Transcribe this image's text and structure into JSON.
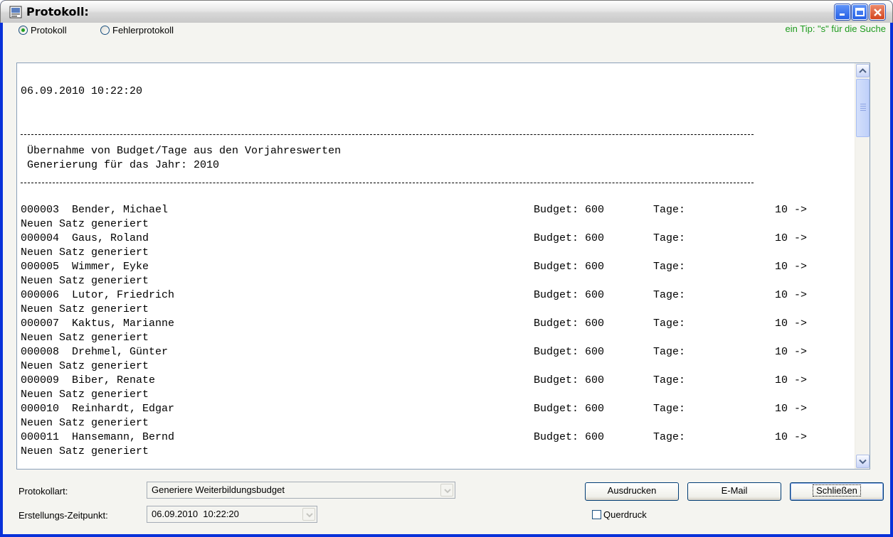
{
  "window": {
    "title": "Protokoll:"
  },
  "mode": {
    "protokoll_label": "Protokoll",
    "fehlerprotokoll_label": "Fehlerprotokoll",
    "selected": "Protokoll",
    "tip": "ein Tip: \"s\" für die Suche"
  },
  "log": {
    "timestamp": "06.09.2010 10:22:20",
    "header_line1": " Übernahme von Budget/Tage aus den Vorjahreswerten",
    "header_line2": " Generierung für das Jahr: 2010",
    "entries": [
      {
        "id_name": "000003  Bender, Michael",
        "budget": "Budget: 600",
        "tage": "Tage:",
        "value": "10 ->",
        "status": "Neuen Satz generiert"
      },
      {
        "id_name": "000004  Gaus, Roland",
        "budget": "Budget: 600",
        "tage": "Tage:",
        "value": "10 ->",
        "status": "Neuen Satz generiert"
      },
      {
        "id_name": "000005  Wimmer, Eyke",
        "budget": "Budget: 600",
        "tage": "Tage:",
        "value": "10 ->",
        "status": "Neuen Satz generiert"
      },
      {
        "id_name": "000006  Lutor, Friedrich",
        "budget": "Budget: 600",
        "tage": "Tage:",
        "value": "10 ->",
        "status": "Neuen Satz generiert"
      },
      {
        "id_name": "000007  Kaktus, Marianne",
        "budget": "Budget: 600",
        "tage": "Tage:",
        "value": "10 ->",
        "status": "Neuen Satz generiert"
      },
      {
        "id_name": "000008  Drehmel, Günter",
        "budget": "Budget: 600",
        "tage": "Tage:",
        "value": "10 ->",
        "status": "Neuen Satz generiert"
      },
      {
        "id_name": "000009  Biber, Renate",
        "budget": "Budget: 600",
        "tage": "Tage:",
        "value": "10 ->",
        "status": "Neuen Satz generiert"
      },
      {
        "id_name": "000010  Reinhardt, Edgar",
        "budget": "Budget: 600",
        "tage": "Tage:",
        "value": "10 ->",
        "status": "Neuen Satz generiert"
      },
      {
        "id_name": "000011  Hansemann, Bernd",
        "budget": "Budget: 600",
        "tage": "Tage:",
        "value": "10 ->",
        "status": "Neuen Satz generiert"
      }
    ]
  },
  "footer": {
    "protokollart_label": "Protokollart:",
    "protokollart_value": "Generiere Weiterbildungsbudget",
    "zeitpunkt_label": "Erstellungs-Zeitpunkt:",
    "zeitpunkt_value": "06.09.2010  10:22:20",
    "ausdrucken": "Ausdrucken",
    "email": "E-Mail",
    "schliessen": "Schließen",
    "querdruck": "Querdruck"
  }
}
